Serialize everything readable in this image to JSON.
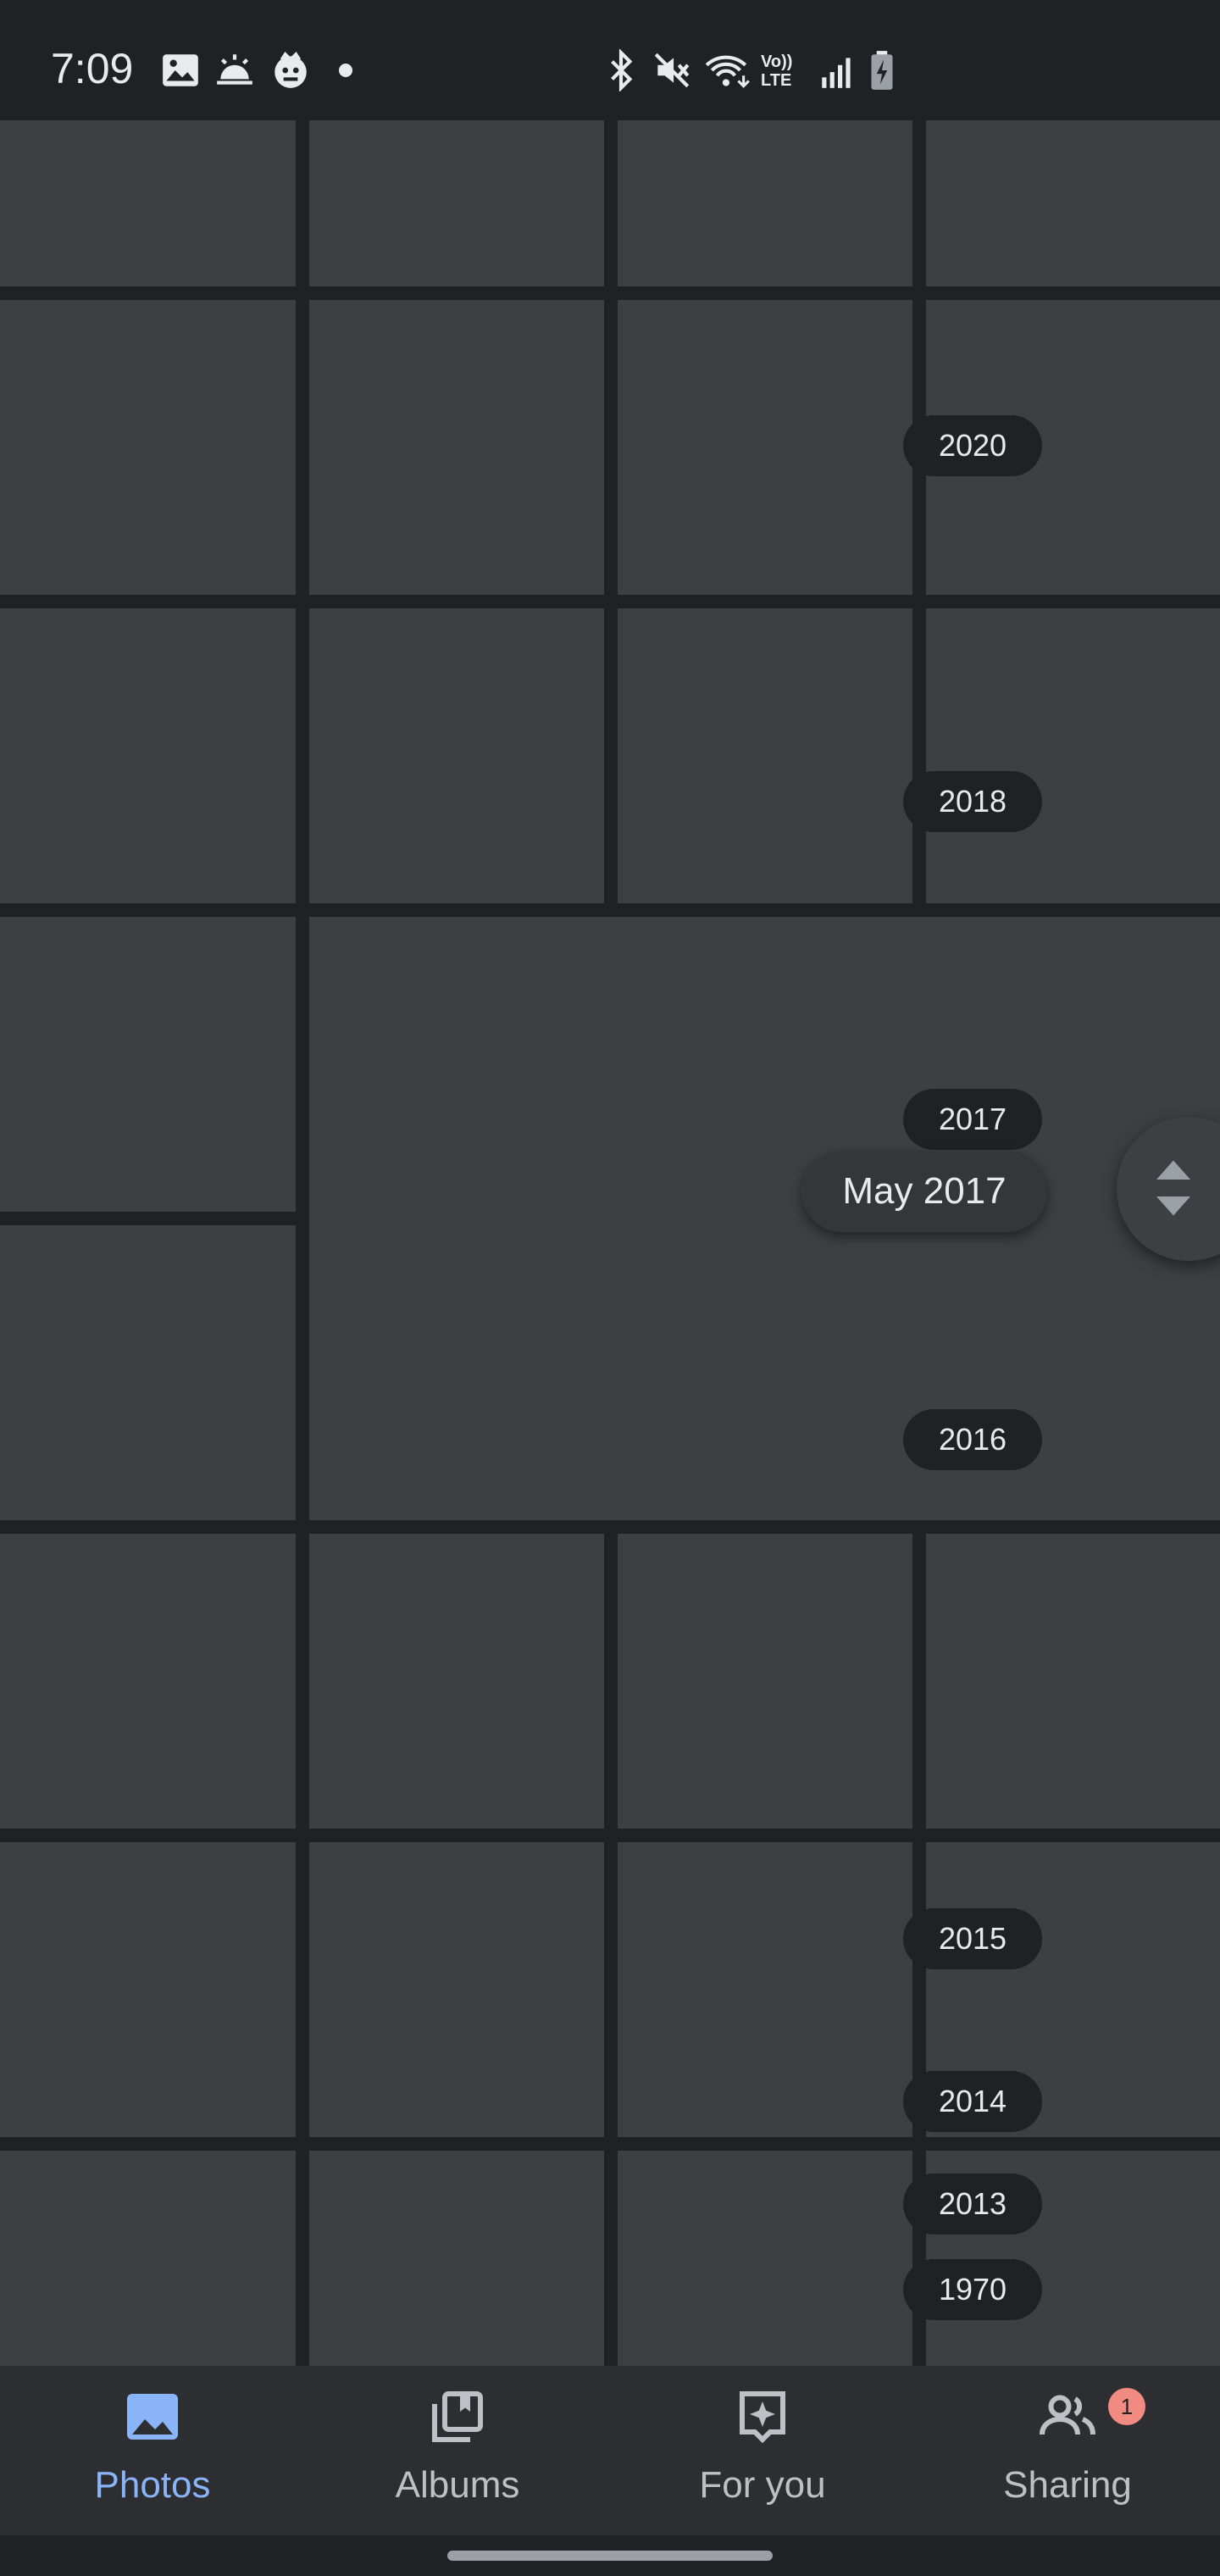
{
  "status_bar": {
    "time": "7:09",
    "left_icons": [
      "gallery-icon",
      "weather-icon",
      "app-icon",
      "dot-icon"
    ],
    "right_icons": [
      "bluetooth-icon",
      "mute-icon",
      "wifi-icon",
      "volte-icon",
      "signal-icon",
      "battery-icon"
    ],
    "volte_text": "Vo)) LTE"
  },
  "timeline": {
    "years": [
      "2020",
      "2018",
      "2017",
      "2016",
      "2015",
      "2014",
      "2013",
      "1970"
    ],
    "current_date": "May 2017"
  },
  "bottom_nav": {
    "items": [
      {
        "label": "Photos",
        "icon": "photos-icon"
      },
      {
        "label": "Albums",
        "icon": "albums-icon"
      },
      {
        "label": "For you",
        "icon": "for-you-icon"
      },
      {
        "label": "Sharing",
        "icon": "sharing-icon"
      }
    ],
    "active": "Photos",
    "sharing_badge": "1"
  },
  "colors": {
    "background": "#202124",
    "tile": "#3c4043",
    "accent": "#8ab4f8",
    "badge": "#f28b82"
  }
}
